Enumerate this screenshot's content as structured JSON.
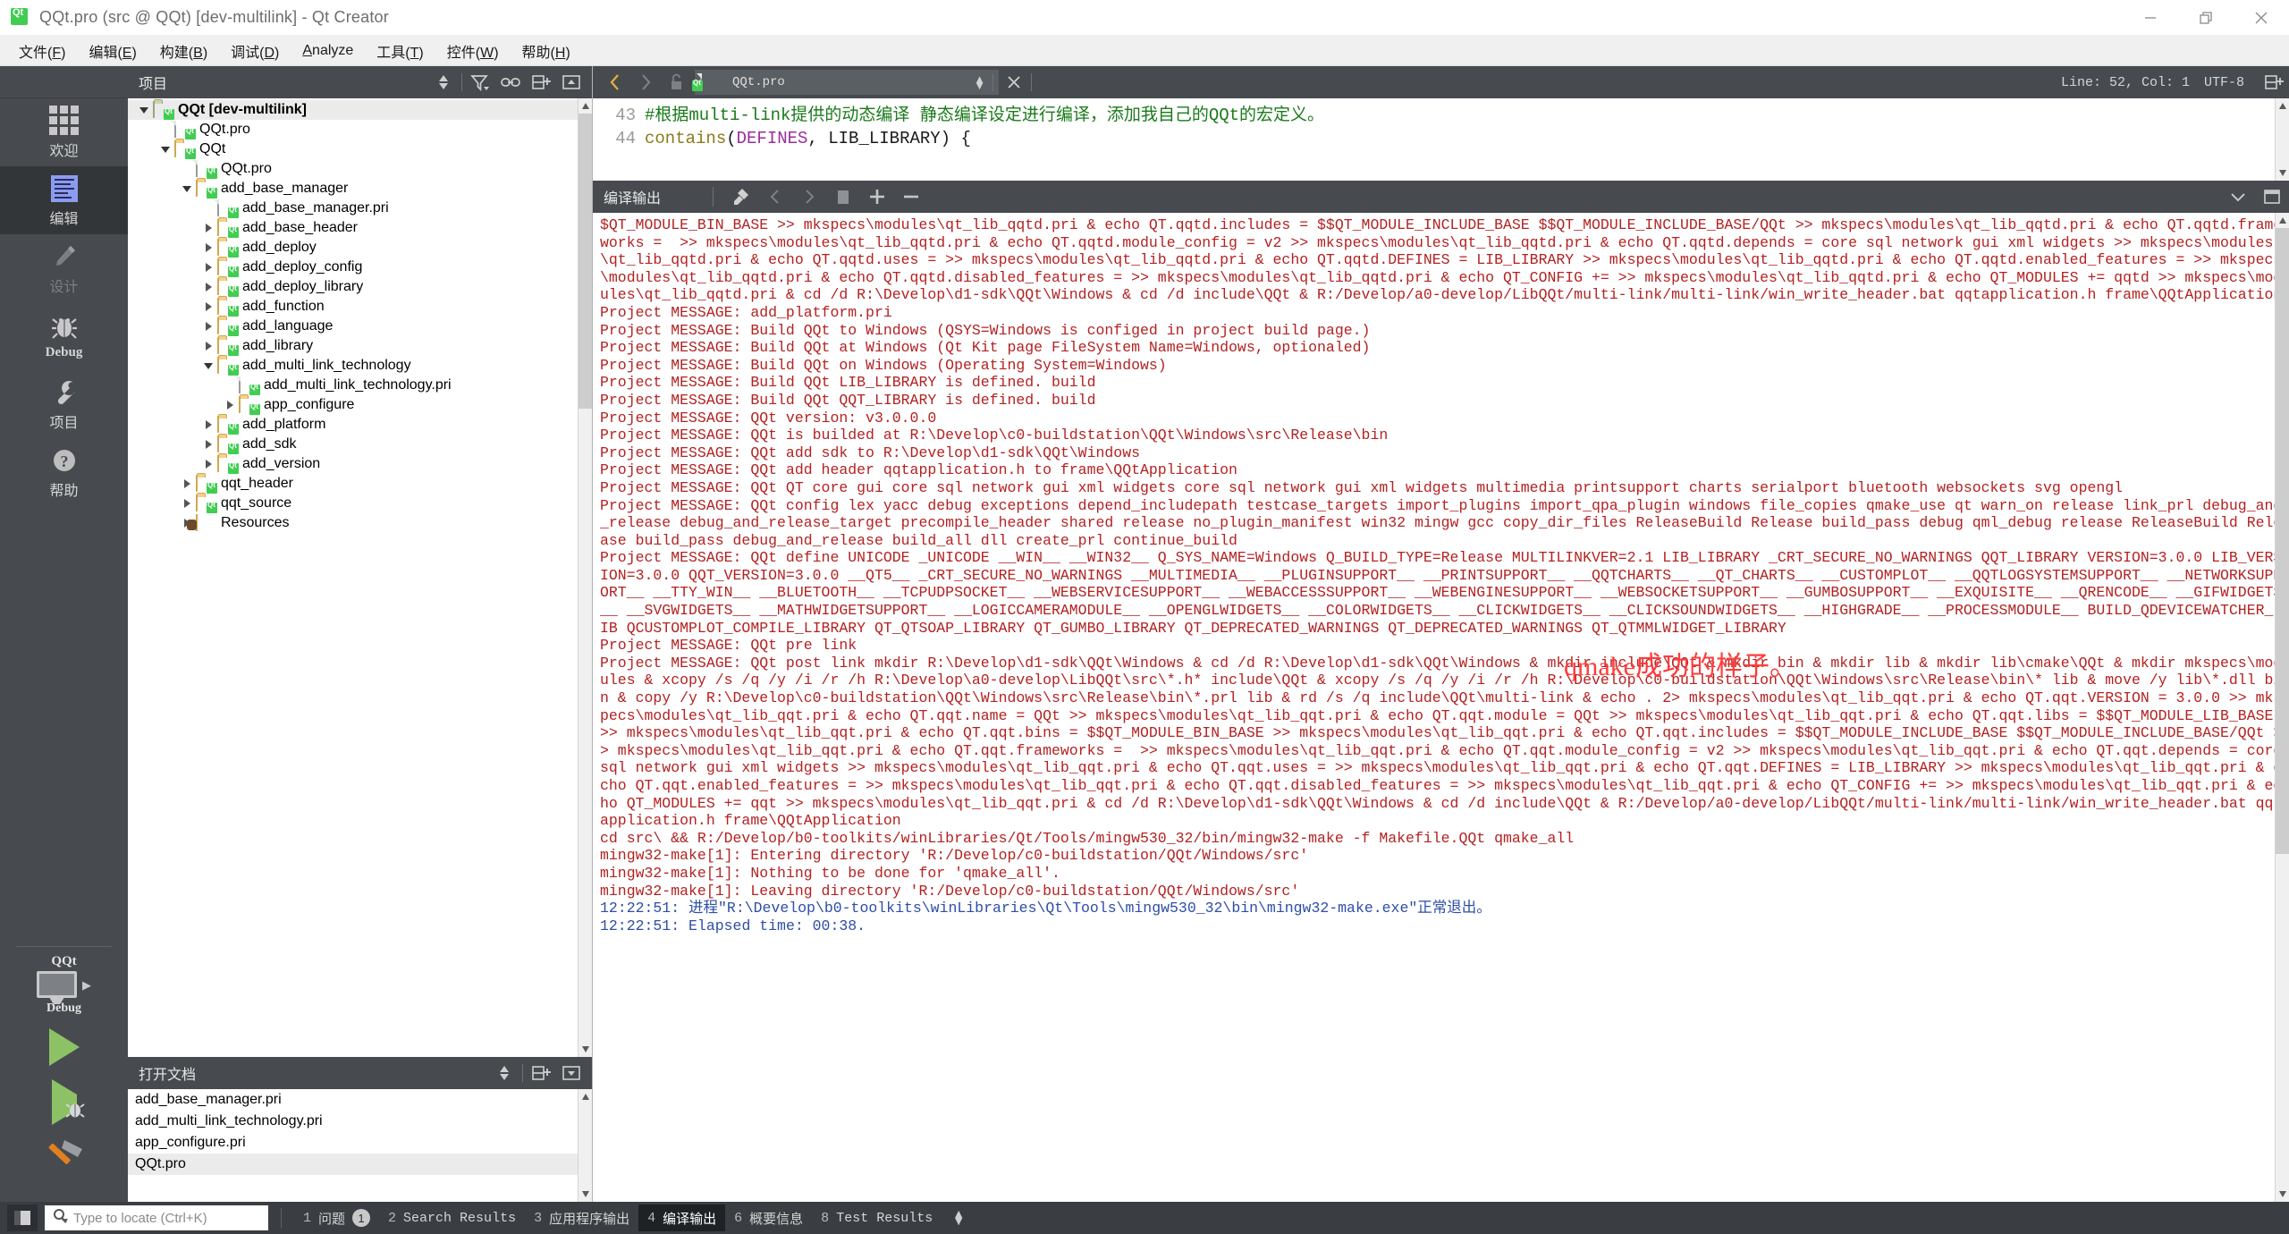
{
  "window": {
    "title": "QQt.pro (src @ QQt) [dev-multilink] - Qt Creator",
    "app_icon": "qt-logo-icon",
    "minimize": "minimize-icon",
    "maximize": "restore-icon",
    "close": "close-icon"
  },
  "menu": [
    {
      "label": "文件(F)",
      "key": "F"
    },
    {
      "label": "编辑(E)",
      "key": "E"
    },
    {
      "label": "构建(B)",
      "key": "B"
    },
    {
      "label": "调试(D)",
      "key": "D"
    },
    {
      "label": "Analyze",
      "key": "A"
    },
    {
      "label": "工具(T)",
      "key": "T"
    },
    {
      "label": "控件(W)",
      "key": "W"
    },
    {
      "label": "帮助(H)",
      "key": "H"
    }
  ],
  "modebar": {
    "items": [
      {
        "label": "欢迎",
        "icon": "grid-icon",
        "state": "normal"
      },
      {
        "label": "编辑",
        "icon": "document-lines-icon",
        "state": "active"
      },
      {
        "label": "设计",
        "icon": "pencil-icon",
        "state": "disabled"
      },
      {
        "label": "Debug",
        "icon": "bug-icon",
        "state": "normal"
      },
      {
        "label": "项目",
        "icon": "wrench-icon",
        "state": "normal"
      },
      {
        "label": "帮助",
        "icon": "question-circle-icon",
        "state": "normal"
      }
    ],
    "kit": {
      "project": "QQt",
      "build_config": "Debug",
      "monitor_icon": "target-monitor-icon",
      "expand_icon": "chevron-right-icon"
    },
    "run_button": "run-icon",
    "debug_button": "debug-run-icon",
    "build_button": "hammer-icon"
  },
  "project_panel": {
    "title": "项目",
    "actions": [
      {
        "name": "sync-icon",
        "glyph": "updown"
      },
      {
        "name": "filter-icon",
        "glyph": "filter"
      },
      {
        "name": "link-icon",
        "glyph": "link"
      },
      {
        "name": "split-add-icon",
        "glyph": "splitadd"
      },
      {
        "name": "collapse-icon",
        "glyph": "collapse-up"
      }
    ],
    "tree": [
      {
        "label": "QQt [dev-multilink]",
        "depth": 0,
        "icon": "project-folder-icon",
        "arrow": "down",
        "bold": true,
        "selected": true
      },
      {
        "label": "QQt.pro",
        "depth": 1,
        "icon": "qt-pro-file-icon",
        "arrow": "none",
        "bold": false,
        "selected": false
      },
      {
        "label": "QQt",
        "depth": 1,
        "icon": "qt-folder-icon",
        "arrow": "down",
        "bold": false,
        "selected": false
      },
      {
        "label": "QQt.pro",
        "depth": 2,
        "icon": "qt-pro-file-icon",
        "arrow": "none",
        "bold": false,
        "selected": false
      },
      {
        "label": "add_base_manager",
        "depth": 2,
        "icon": "qt-folder-icon",
        "arrow": "down",
        "bold": false,
        "selected": false
      },
      {
        "label": "add_base_manager.pri",
        "depth": 3,
        "icon": "qt-pri-file-icon",
        "arrow": "none",
        "bold": false,
        "selected": false
      },
      {
        "label": "add_base_header",
        "depth": 3,
        "icon": "qt-folder-icon",
        "arrow": "right",
        "bold": false,
        "selected": false
      },
      {
        "label": "add_deploy",
        "depth": 3,
        "icon": "qt-folder-icon",
        "arrow": "right",
        "bold": false,
        "selected": false
      },
      {
        "label": "add_deploy_config",
        "depth": 3,
        "icon": "qt-folder-icon",
        "arrow": "right",
        "bold": false,
        "selected": false
      },
      {
        "label": "add_deploy_library",
        "depth": 3,
        "icon": "qt-folder-icon",
        "arrow": "right",
        "bold": false,
        "selected": false
      },
      {
        "label": "add_function",
        "depth": 3,
        "icon": "qt-folder-icon",
        "arrow": "right",
        "bold": false,
        "selected": false
      },
      {
        "label": "add_language",
        "depth": 3,
        "icon": "qt-folder-icon",
        "arrow": "right",
        "bold": false,
        "selected": false
      },
      {
        "label": "add_library",
        "depth": 3,
        "icon": "qt-folder-icon",
        "arrow": "right",
        "bold": false,
        "selected": false
      },
      {
        "label": "add_multi_link_technology",
        "depth": 3,
        "icon": "qt-folder-icon",
        "arrow": "down",
        "bold": false,
        "selected": false
      },
      {
        "label": "add_multi_link_technology.pri",
        "depth": 4,
        "icon": "qt-pri-file-icon",
        "arrow": "none",
        "bold": false,
        "selected": false
      },
      {
        "label": "app_configure",
        "depth": 4,
        "icon": "qt-folder-icon",
        "arrow": "right",
        "bold": false,
        "selected": false
      },
      {
        "label": "add_platform",
        "depth": 3,
        "icon": "qt-folder-icon",
        "arrow": "right",
        "bold": false,
        "selected": false
      },
      {
        "label": "add_sdk",
        "depth": 3,
        "icon": "qt-folder-icon",
        "arrow": "right",
        "bold": false,
        "selected": false
      },
      {
        "label": "add_version",
        "depth": 3,
        "icon": "qt-folder-icon",
        "arrow": "right",
        "bold": false,
        "selected": false
      },
      {
        "label": "qqt_header",
        "depth": 2,
        "icon": "qt-folder-icon",
        "arrow": "right",
        "bold": false,
        "selected": false
      },
      {
        "label": "qqt_source",
        "depth": 2,
        "icon": "qt-folder-icon",
        "arrow": "right",
        "bold": false,
        "selected": false
      },
      {
        "label": "Resources",
        "depth": 2,
        "icon": "resource-folder-icon",
        "arrow": "right",
        "bold": false,
        "selected": false
      }
    ]
  },
  "open_documents": {
    "title": "打开文档",
    "actions": [
      {
        "name": "sync-icon",
        "glyph": "updown"
      },
      {
        "name": "split-add-icon",
        "glyph": "splitadd"
      },
      {
        "name": "collapse-icon",
        "glyph": "collapse-down"
      }
    ],
    "items": [
      {
        "label": "add_base_manager.pri",
        "selected": false
      },
      {
        "label": "add_multi_link_technology.pri",
        "selected": false
      },
      {
        "label": "app_configure.pri",
        "selected": false
      },
      {
        "label": "QQt.pro",
        "selected": true
      }
    ]
  },
  "editor": {
    "toolbar": {
      "back": "back-arrow-icon",
      "forward": "forward-arrow-icon",
      "lock": "unlocked-padlock-icon",
      "file_icon": "qt-pro-file-icon",
      "filename": "QQt.pro",
      "dropdown": "updown-chevron-icon",
      "close": "close-document-icon",
      "cursor_position": "Line: 52, Col: 1",
      "encoding": "UTF-8",
      "split_icon": "split-add-icon"
    },
    "lines": [
      {
        "number": "43",
        "tokens": [
          {
            "text": "#根据multi-link提供的动态编译 静态编译设定进行编译，添加我自己的QQt的宏定义。",
            "cls": "c-comment"
          }
        ]
      },
      {
        "number": "44",
        "tokens": [
          {
            "text": "contains",
            "cls": "c-func"
          },
          {
            "text": "(",
            "cls": "c-plain"
          },
          {
            "text": "DEFINES",
            "cls": "c-var"
          },
          {
            "text": ", LIB_LIBRARY) {",
            "cls": "c-plain"
          }
        ]
      }
    ]
  },
  "output_pane": {
    "title": "编译输出",
    "actions": [
      {
        "name": "clear-output-icon",
        "glyph": "broom"
      },
      {
        "name": "previous-item-icon",
        "glyph": "prev"
      },
      {
        "name": "next-item-icon",
        "glyph": "next"
      },
      {
        "name": "stop-icon",
        "glyph": "stop"
      },
      {
        "name": "zoom-in-icon",
        "glyph": "plus"
      },
      {
        "name": "zoom-out-icon",
        "glyph": "minus"
      }
    ],
    "collapse_icon": "chevron-down-icon",
    "maximize_icon": "maximize-pane-icon",
    "annotation": "qmake成功的样子。",
    "annotation_color": "#ff3c3c",
    "text_color": "#b32222",
    "timestamp_color": "#2d4ea8",
    "body": "$QT_MODULE_BIN_BASE >> mkspecs\\modules\\qt_lib_qqtd.pri & echo QT.qqtd.includes = $$QT_MODULE_INCLUDE_BASE $$QT_MODULE_INCLUDE_BASE/QQt >> mkspecs\\modules\\qt_lib_qqtd.pri & echo QT.qqtd.frameworks =  >> mkspecs\\modules\\qt_lib_qqtd.pri & echo QT.qqtd.module_config = v2 >> mkspecs\\modules\\qt_lib_qqtd.pri & echo QT.qqtd.depends = core sql network gui xml widgets >> mkspecs\\modules\\qt_lib_qqtd.pri & echo QT.qqtd.uses = >> mkspecs\\modules\\qt_lib_qqtd.pri & echo QT.qqtd.DEFINES = LIB_LIBRARY >> mkspecs\\modules\\qt_lib_qqtd.pri & echo QT.qqtd.enabled_features = >> mkspecs\\modules\\qt_lib_qqtd.pri & echo QT.qqtd.disabled_features = >> mkspecs\\modules\\qt_lib_qqtd.pri & echo QT_CONFIG += >> mkspecs\\modules\\qt_lib_qqtd.pri & echo QT_MODULES += qqtd >> mkspecs\\modules\\qt_lib_qqtd.pri & cd /d R:\\Develop\\d1-sdk\\QQt\\Windows & cd /d include\\QQt & R:/Develop/a0-develop/LibQQt/multi-link/multi-link/win_write_header.bat qqtapplication.h frame\\QQtApplication\nProject MESSAGE: add_platform.pri\nProject MESSAGE: Build QQt to Windows (QSYS=Windows is configed in project build page.)\nProject MESSAGE: Build QQt at Windows (Qt Kit page FileSystem Name=Windows, optionaled)\nProject MESSAGE: Build QQt on Windows (Operating System=Windows)\nProject MESSAGE: Build QQt LIB_LIBRARY is defined. build\nProject MESSAGE: Build QQt QQT_LIBRARY is defined. build\nProject MESSAGE: QQt version: v3.0.0.0\nProject MESSAGE: QQt is builded at R:\\Develop\\c0-buildstation\\QQt\\Windows\\src\\Release\\bin\nProject MESSAGE: QQt add sdk to R:\\Develop\\d1-sdk\\QQt\\Windows\nProject MESSAGE: QQt add header qqtapplication.h to frame\\QQtApplication\nProject MESSAGE: QQt QT core gui core sql network gui xml widgets core sql network gui xml widgets multimedia printsupport charts serialport bluetooth websockets svg opengl\nProject MESSAGE: QQt config lex yacc debug exceptions depend_includepath testcase_targets import_plugins import_qpa_plugin windows file_copies qmake_use qt warn_on release link_prl debug_and_release debug_and_release_target precompile_header shared release no_plugin_manifest win32 mingw gcc copy_dir_files ReleaseBuild Release build_pass debug qml_debug release ReleaseBuild Release build_pass debug_and_release build_all dll create_prl continue_build\nProject MESSAGE: QQt define UNICODE _UNICODE __WIN__ __WIN32__ Q_SYS_NAME=Windows Q_BUILD_TYPE=Release MULTILINKVER=2.1 LIB_LIBRARY _CRT_SECURE_NO_WARNINGS QQT_LIBRARY VERSION=3.0.0 LIB_VERSION=3.0.0 QQT_VERSION=3.0.0 __QT5__ _CRT_SECURE_NO_WARNINGS __MULTIMEDIA__ __PLUGINSUPPORT__ __PRINTSUPPORT__ __QQTCHARTS__ __QT_CHARTS__ __CUSTOMPLOT__ __QQTLOGSYSTEMSUPPORT__ __NETWORKSUPPORT__ __TTY_WIN__ __BLUETOOTH__ __TCPUDPSOCKET__ __WEBSERVICESUPPORT__ __WEBACCESSSUPPORT__ __WEBENGINESUPPORT__ __WEBSOCKETSUPPORT__ __GUMBOSUPPORT__ __EXQUISITE__ __QRENCODE__ __GIFWIDGETS__ __SVGWIDGETS__ __MATHWIDGETSUPPORT__ __LOGICCAMERAMODULE__ __OPENGLWIDGETS__ __COLORWIDGETS__ __CLICKWIDGETS__ __CLICKSOUNDWIDGETS__ __HIGHGRADE__ __PROCESSMODULE__ BUILD_QDEVICEWATCHER_LIB QCUSTOMPLOT_COMPILE_LIBRARY QT_QTSOAP_LIBRARY QT_GUMBO_LIBRARY QT_DEPRECATED_WARNINGS QT_DEPRECATED_WARNINGS QT_QTMMLWIDGET_LIBRARY\nProject MESSAGE: QQt pre link\nProject MESSAGE: QQt post link mkdir R:\\Develop\\d1-sdk\\QQt\\Windows & cd /d R:\\Develop\\d1-sdk\\QQt\\Windows & mkdir include\\QQt & mkdir bin & mkdir lib & mkdir lib\\cmake\\QQt & mkdir mkspecs\\modules & xcopy /s /q /y /i /r /h R:\\Develop\\a0-develop\\LibQQt\\src\\*.h* include\\QQt & xcopy /s /q /y /i /r /h R:\\Develop\\c0-buildstation\\QQt\\Windows\\src\\Release\\bin\\* lib & move /y lib\\*.dll bin & copy /y R:\\Develop\\c0-buildstation\\QQt\\Windows\\src\\Release\\bin\\*.prl lib & rd /s /q include\\QQt\\multi-link & echo . 2> mkspecs\\modules\\qt_lib_qqt.pri & echo QT.qqt.VERSION = 3.0.0 >> mkspecs\\modules\\qt_lib_qqt.pri & echo QT.qqt.name = QQt >> mkspecs\\modules\\qt_lib_qqt.pri & echo QT.qqt.module = QQt >> mkspecs\\modules\\qt_lib_qqt.pri & echo QT.qqt.libs = $$QT_MODULE_LIB_BASE >> mkspecs\\modules\\qt_lib_qqt.pri & echo QT.qqt.bins = $$QT_MODULE_BIN_BASE >> mkspecs\\modules\\qt_lib_qqt.pri & echo QT.qqt.includes = $$QT_MODULE_INCLUDE_BASE $$QT_MODULE_INCLUDE_BASE/QQt >> mkspecs\\modules\\qt_lib_qqt.pri & echo QT.qqt.frameworks =  >> mkspecs\\modules\\qt_lib_qqt.pri & echo QT.qqt.module_config = v2 >> mkspecs\\modules\\qt_lib_qqt.pri & echo QT.qqt.depends = core sql network gui xml widgets >> mkspecs\\modules\\qt_lib_qqt.pri & echo QT.qqt.uses = >> mkspecs\\modules\\qt_lib_qqt.pri & echo QT.qqt.DEFINES = LIB_LIBRARY >> mkspecs\\modules\\qt_lib_qqt.pri & echo QT.qqt.enabled_features = >> mkspecs\\modules\\qt_lib_qqt.pri & echo QT.qqt.disabled_features = >> mkspecs\\modules\\qt_lib_qqt.pri & echo QT_CONFIG += >> mkspecs\\modules\\qt_lib_qqt.pri & echo QT_MODULES += qqt >> mkspecs\\modules\\qt_lib_qqt.pri & cd /d R:\\Develop\\d1-sdk\\QQt\\Windows & cd /d include\\QQt & R:/Develop/a0-develop/LibQQt/multi-link/multi-link/win_write_header.bat qqtapplication.h frame\\QQtApplication\ncd src\\ && R:/Develop/b0-toolkits/winLibraries/Qt/Tools/mingw530_32/bin/mingw32-make -f Makefile.QQt qmake_all\nmingw32-make[1]: Entering directory 'R:/Develop/c0-buildstation/QQt/Windows/src'\nmingw32-make[1]: Nothing to be done for 'qmake_all'.\nmingw32-make[1]: Leaving directory 'R:/Develop/c0-buildstation/QQt/Windows/src'",
    "footer_lines": [
      {
        "time": "12:22:51: ",
        "text": "进程\"R:\\Develop\\b0-toolkits\\winLibraries\\Qt\\Tools\\mingw530_32\\bin\\mingw32-make.exe\"正常退出。"
      },
      {
        "time": "12:22:51: ",
        "text": "Elapsed time: 00:38."
      }
    ]
  },
  "statusbar": {
    "sidebar_toggle": "sidebar-toggle-icon",
    "locator": {
      "icon": "search-icon",
      "placeholder": "Type to locate (Ctrl+K)",
      "value": ""
    },
    "tabs": [
      {
        "num": "1",
        "label": "问题",
        "badge": "1",
        "active": false,
        "mono": false
      },
      {
        "num": "2",
        "label": "Search Results",
        "badge": "",
        "active": false,
        "mono": true
      },
      {
        "num": "3",
        "label": "应用程序输出",
        "badge": "",
        "active": false,
        "mono": false
      },
      {
        "num": "4",
        "label": "编译输出",
        "badge": "",
        "active": true,
        "mono": false
      },
      {
        "num": "6",
        "label": "概要信息",
        "badge": "",
        "active": false,
        "mono": false
      },
      {
        "num": "8",
        "label": "Test Results",
        "badge": "",
        "active": false,
        "mono": true
      }
    ],
    "updown_icon": "updown-chevron-icon"
  },
  "colors": {
    "chrome_dark": "#474b4f",
    "statusbar": "#3a3e42",
    "accent_qt_green": "#41cd52",
    "output_red": "#b32222",
    "annotation_red": "#ff3c3c",
    "timestamp_blue": "#2d4ea8",
    "comment_green": "#1a7a1a",
    "keyword_purple": "#9b2d9b"
  }
}
